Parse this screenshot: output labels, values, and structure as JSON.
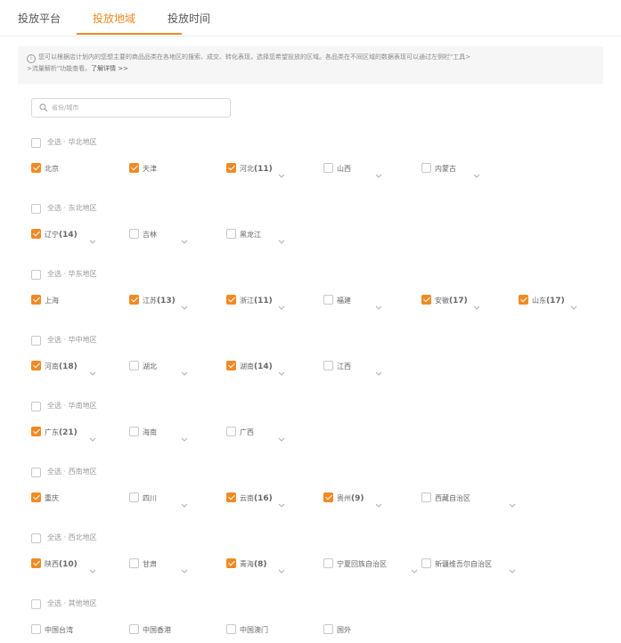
{
  "tabs": [
    {
      "label": "投放平台",
      "active": false
    },
    {
      "label": "投放地域",
      "active": true
    },
    {
      "label": "投放时间",
      "active": false
    }
  ],
  "notice": {
    "line1": "您可以根据店计划内的您想主要的商品品类在各地区的搜索、成交、转化表现，选择您希望投放的区域。各品类在不同区域的数据表现可以通过左侧栏\"工具>",
    "line2": ">流量解析\"功能查看。",
    "link": "了解详情 >>"
  },
  "search": {
    "placeholder": "省份/城市"
  },
  "colors": {
    "accent": "#f08a24",
    "checkbox_border": "#c8c8c8",
    "notice_bg": "#f6f6f6"
  },
  "groups": [
    {
      "title": "全选 · 华北地区",
      "items": [
        {
          "name": "北京",
          "count": "",
          "checked": true,
          "dropdown": false
        },
        {
          "name": "天津",
          "count": "",
          "checked": true,
          "dropdown": false
        },
        {
          "name": "河北",
          "count": "(11)",
          "checked": true,
          "dropdown": true
        },
        {
          "name": "山西",
          "count": "",
          "checked": false,
          "dropdown": true
        },
        {
          "name": "内蒙古",
          "count": "",
          "checked": false,
          "dropdown": true
        }
      ]
    },
    {
      "title": "全选 · 东北地区",
      "items": [
        {
          "name": "辽宁",
          "count": "(14)",
          "checked": true,
          "dropdown": true
        },
        {
          "name": "吉林",
          "count": "",
          "checked": false,
          "dropdown": true
        },
        {
          "name": "黑龙江",
          "count": "",
          "checked": false,
          "dropdown": true
        }
      ]
    },
    {
      "title": "全选 · 华东地区",
      "items": [
        {
          "name": "上海",
          "count": "",
          "checked": true,
          "dropdown": false
        },
        {
          "name": "江苏",
          "count": "(13)",
          "checked": true,
          "dropdown": true
        },
        {
          "name": "浙江",
          "count": "(11)",
          "checked": true,
          "dropdown": true
        },
        {
          "name": "福建",
          "count": "",
          "checked": false,
          "dropdown": true
        },
        {
          "name": "安徽",
          "count": "(17)",
          "checked": true,
          "dropdown": true
        },
        {
          "name": "山东",
          "count": "(17)",
          "checked": true,
          "dropdown": true
        }
      ]
    },
    {
      "title": "全选 · 华中地区",
      "items": [
        {
          "name": "河南",
          "count": "(18)",
          "checked": true,
          "dropdown": true
        },
        {
          "name": "湖北",
          "count": "",
          "checked": false,
          "dropdown": true
        },
        {
          "name": "湖南",
          "count": "(14)",
          "checked": true,
          "dropdown": true
        },
        {
          "name": "江西",
          "count": "",
          "checked": false,
          "dropdown": true
        }
      ]
    },
    {
      "title": "全选 · 华南地区",
      "items": [
        {
          "name": "广东",
          "count": "(21)",
          "checked": true,
          "dropdown": true
        },
        {
          "name": "海南",
          "count": "",
          "checked": false,
          "dropdown": true
        },
        {
          "name": "广西",
          "count": "",
          "checked": false,
          "dropdown": true
        }
      ]
    },
    {
      "title": "全选 · 西南地区",
      "items": [
        {
          "name": "重庆",
          "count": "",
          "checked": true,
          "dropdown": false
        },
        {
          "name": "四川",
          "count": "",
          "checked": false,
          "dropdown": true
        },
        {
          "name": "云南",
          "count": "(16)",
          "checked": true,
          "dropdown": true
        },
        {
          "name": "贵州",
          "count": "(9)",
          "checked": true,
          "dropdown": true
        },
        {
          "name": "西藏自治区",
          "count": "",
          "checked": false,
          "dropdown": true
        }
      ]
    },
    {
      "title": "全选 · 西北地区",
      "items": [
        {
          "name": "陕西",
          "count": "(10)",
          "checked": true,
          "dropdown": true
        },
        {
          "name": "甘肃",
          "count": "",
          "checked": false,
          "dropdown": true
        },
        {
          "name": "青海",
          "count": "(8)",
          "checked": true,
          "dropdown": true
        },
        {
          "name": "宁夏回族自治区",
          "count": "",
          "checked": false,
          "dropdown": true
        },
        {
          "name": "新疆维吾尔自治区",
          "count": "",
          "checked": false,
          "dropdown": true
        }
      ]
    },
    {
      "title": "全选 · 其他地区",
      "items": [
        {
          "name": "中国台湾",
          "count": "",
          "checked": false,
          "dropdown": false
        },
        {
          "name": "中国香港",
          "count": "",
          "checked": false,
          "dropdown": false
        },
        {
          "name": "中国澳门",
          "count": "",
          "checked": false,
          "dropdown": false
        },
        {
          "name": "国外",
          "count": "",
          "checked": false,
          "dropdown": false
        }
      ]
    }
  ]
}
